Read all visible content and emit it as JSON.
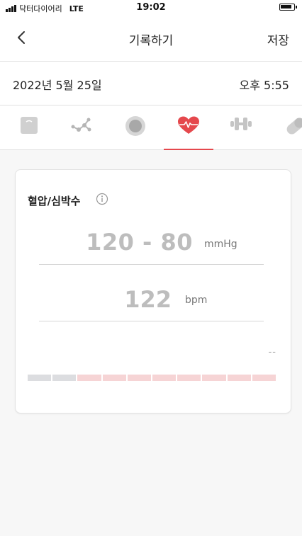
{
  "status_bar": {
    "carrier": "닥터다이어리",
    "network": "LTE",
    "time": "19:02"
  },
  "nav": {
    "title": "기록하기",
    "save_label": "저장"
  },
  "datebar": {
    "date": "2022년 5월 25일",
    "time": "오후 5:55"
  },
  "categories": [
    {
      "name": "weight",
      "icon": "scale-icon",
      "active": false
    },
    {
      "name": "molecule",
      "icon": "molecule-icon",
      "active": false
    },
    {
      "name": "circle",
      "icon": "target-icon",
      "active": false
    },
    {
      "name": "heart",
      "icon": "heart-pulse-icon",
      "active": true
    },
    {
      "name": "exercise",
      "icon": "dumbbell-icon",
      "active": false
    },
    {
      "name": "medicine",
      "icon": "pill-icon",
      "active": false
    }
  ],
  "card": {
    "title": "혈압/심박수",
    "blood_pressure": "120 - 80",
    "bp_unit": "mmHg",
    "heart_rate": "122",
    "hr_unit": "bpm",
    "placeholder": "--",
    "scale_segments": [
      "gray",
      "gray",
      "pink",
      "pink",
      "pink",
      "pink",
      "pink",
      "pink",
      "pink",
      "pink"
    ]
  },
  "colors": {
    "accent": "#e5484d",
    "value_gray": "#bdbdbd",
    "scale_gray": "#dcdde0",
    "scale_pink": "#f6d4d5"
  }
}
